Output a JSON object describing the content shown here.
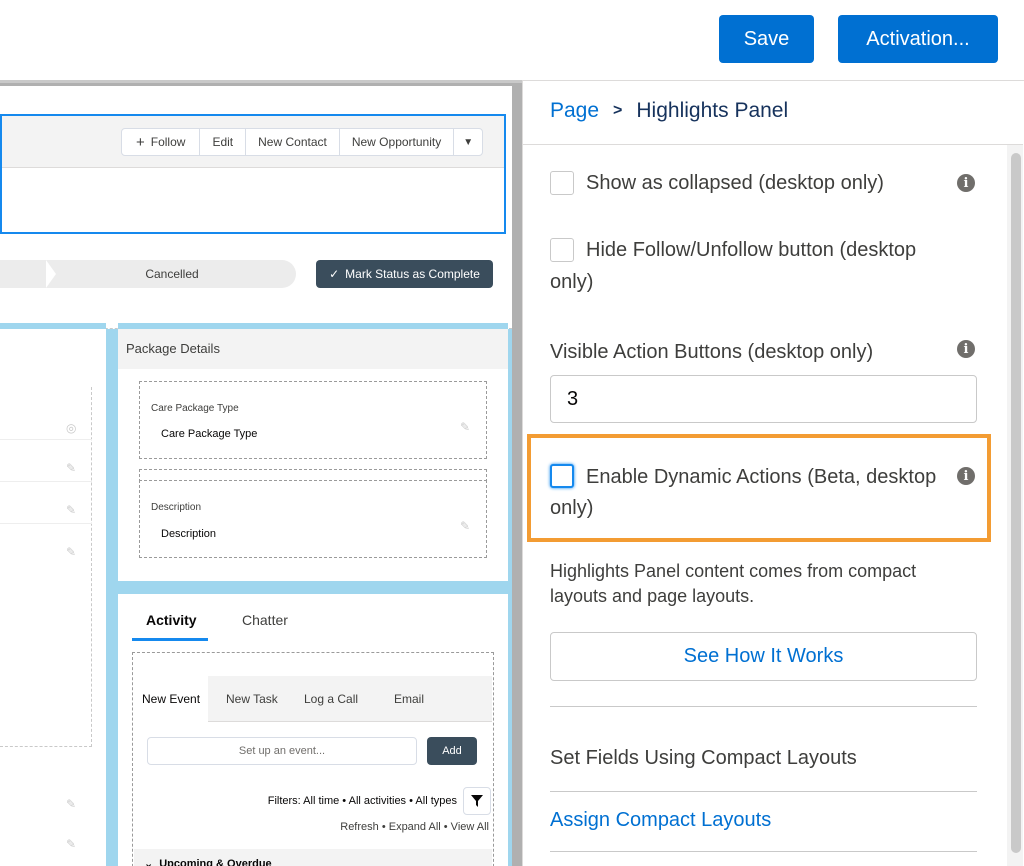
{
  "toolbar": {
    "save_label": "Save",
    "activation_label": "Activation..."
  },
  "canvas": {
    "actions": {
      "follow": "Follow",
      "edit": "Edit",
      "new_contact": "New Contact",
      "new_opportunity": "New Opportunity"
    },
    "path": {
      "stage": "Cancelled",
      "mark_complete": "Mark Status as Complete"
    },
    "package_details": {
      "title": "Package Details",
      "fields": [
        {
          "label": "Care Package Type",
          "value": "Care Package Type"
        },
        {
          "label": "Description",
          "value": "Description"
        }
      ]
    },
    "activity": {
      "tabs": [
        "Activity",
        "Chatter"
      ],
      "sub_tabs": [
        "New Event",
        "New Task",
        "Log a Call",
        "Email"
      ],
      "event_placeholder": "Set up an event...",
      "add_label": "Add",
      "filters": "Filters: All time • All activities • All types",
      "refresh_links": "Refresh • Expand All • View All",
      "upcoming": "Upcoming & Overdue"
    }
  },
  "panel": {
    "breadcrumb": {
      "root": "Page",
      "separator": ">",
      "current": "Highlights Panel"
    },
    "options": {
      "show_collapsed": "Show as collapsed (desktop only)",
      "hide_follow_line1": "Hide Follow/Unfollow button (desktop",
      "hide_follow_line2": "only)",
      "visible_actions_label": "Visible Action Buttons (desktop only)",
      "visible_actions_value": "3",
      "dynamic_actions_line1": "Enable Dynamic Actions (Beta, desktop",
      "dynamic_actions_line2": "only)"
    },
    "help_text": "Highlights Panel content comes from compact layouts and page layouts.",
    "see_how": "See How It Works",
    "set_fields": "Set Fields Using Compact Layouts",
    "assign_link": "Assign Compact Layouts"
  },
  "colors": {
    "brand": "#0070d2",
    "highlight": "#f39c33",
    "canvas_accent": "#9fd6ee"
  }
}
